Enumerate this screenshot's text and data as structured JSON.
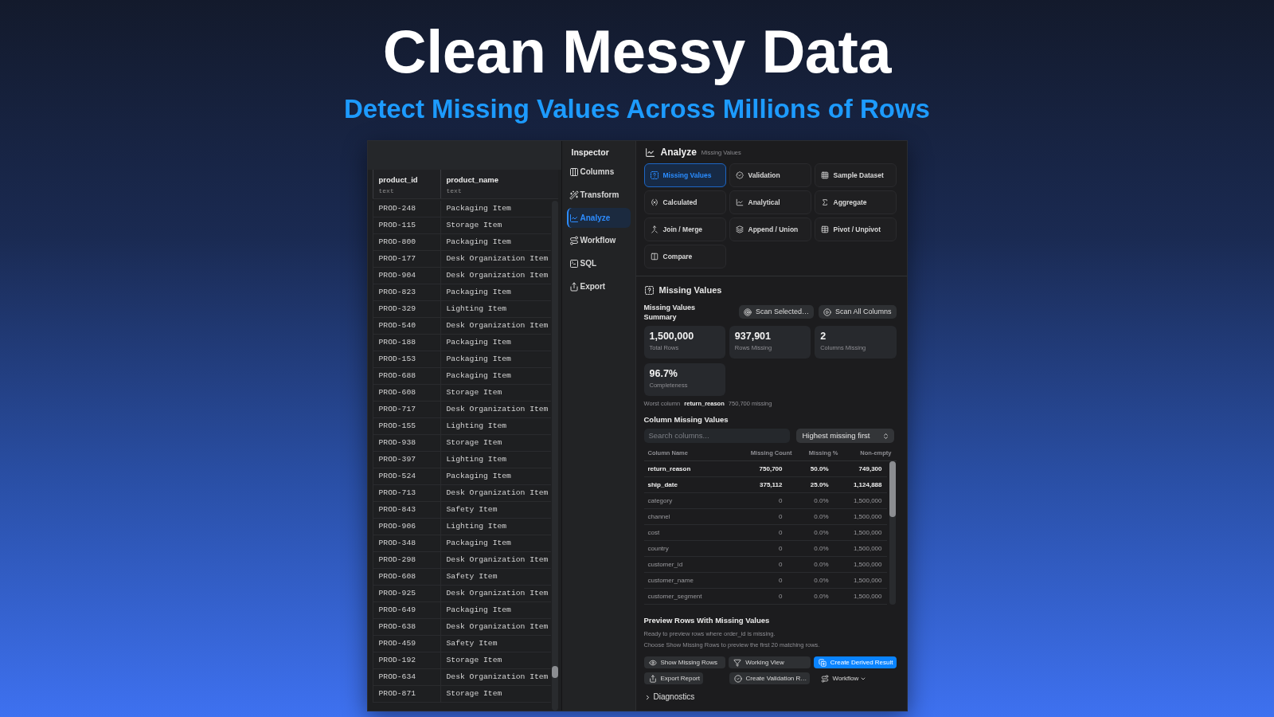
{
  "hero": {
    "title": "Clean Messy Data",
    "subtitle": "Detect Missing Values Across Millions of Rows"
  },
  "data_grid": {
    "columns": [
      {
        "name": "product_id",
        "type": "text"
      },
      {
        "name": "product_name",
        "type": "text"
      }
    ],
    "rows": [
      [
        "PROD-248",
        "Packaging Item"
      ],
      [
        "PROD-115",
        "Storage Item"
      ],
      [
        "PROD-800",
        "Packaging Item"
      ],
      [
        "PROD-177",
        "Desk Organization Item"
      ],
      [
        "PROD-904",
        "Desk Organization Item"
      ],
      [
        "PROD-823",
        "Packaging Item"
      ],
      [
        "PROD-329",
        "Lighting Item"
      ],
      [
        "PROD-540",
        "Desk Organization Item"
      ],
      [
        "PROD-188",
        "Packaging Item"
      ],
      [
        "PROD-153",
        "Packaging Item"
      ],
      [
        "PROD-688",
        "Packaging Item"
      ],
      [
        "PROD-608",
        "Storage Item"
      ],
      [
        "PROD-717",
        "Desk Organization Item"
      ],
      [
        "PROD-155",
        "Lighting Item"
      ],
      [
        "PROD-938",
        "Storage Item"
      ],
      [
        "PROD-397",
        "Lighting Item"
      ],
      [
        "PROD-524",
        "Packaging Item"
      ],
      [
        "PROD-713",
        "Desk Organization Item"
      ],
      [
        "PROD-843",
        "Safety Item"
      ],
      [
        "PROD-906",
        "Lighting Item"
      ],
      [
        "PROD-348",
        "Packaging Item"
      ],
      [
        "PROD-298",
        "Desk Organization Item"
      ],
      [
        "PROD-608",
        "Safety Item"
      ],
      [
        "PROD-925",
        "Desk Organization Item"
      ],
      [
        "PROD-649",
        "Packaging Item"
      ],
      [
        "PROD-638",
        "Desk Organization Item"
      ],
      [
        "PROD-459",
        "Safety Item"
      ],
      [
        "PROD-192",
        "Storage Item"
      ],
      [
        "PROD-634",
        "Desk Organization Item"
      ],
      [
        "PROD-871",
        "Storage Item"
      ]
    ]
  },
  "inspector": {
    "title": "Inspector",
    "items": [
      {
        "label": "Columns",
        "selected": false
      },
      {
        "label": "Transform",
        "selected": false
      },
      {
        "label": "Analyze",
        "selected": true
      },
      {
        "label": "Workflow",
        "selected": false
      },
      {
        "label": "SQL",
        "selected": false
      },
      {
        "label": "Export",
        "selected": false
      }
    ]
  },
  "analyze": {
    "title": "Analyze",
    "subtitle": "Missing Values",
    "tools": [
      {
        "label": "Missing Values",
        "selected": true
      },
      {
        "label": "Validation",
        "selected": false
      },
      {
        "label": "Sample Dataset",
        "selected": false
      },
      {
        "label": "Calculated",
        "selected": false
      },
      {
        "label": "Analytical",
        "selected": false
      },
      {
        "label": "Aggregate",
        "selected": false
      },
      {
        "label": "Join / Merge",
        "selected": false
      },
      {
        "label": "Append / Union",
        "selected": false
      },
      {
        "label": "Pivot / Unpivot",
        "selected": false
      },
      {
        "label": "Compare",
        "selected": false
      }
    ]
  },
  "missing_values": {
    "title": "Missing Values",
    "summary_title": "Missing Values Summary",
    "scan_buttons": [
      "Scan Selected…",
      "Scan All Columns"
    ],
    "stats": [
      {
        "value": "1,500,000",
        "label": "Total Rows"
      },
      {
        "value": "937,901",
        "label": "Rows Missing"
      },
      {
        "value": "2",
        "label": "Columns Missing"
      },
      {
        "value": "96.7%",
        "label": "Completeness"
      }
    ],
    "worst_column": "Worst column **return_reason** 750,700 missing",
    "column_section": {
      "title": "Column Missing Values",
      "search": {
        "placeholder": "Search columns..."
      },
      "sort": {
        "value": "Highest missing first"
      },
      "table": {
        "columns": [
          "Column Name",
          "Missing Count",
          "Missing %",
          "Non-empty"
        ],
        "rows": [
          {
            "cells": [
              "return_reason",
              "750,700",
              "50.0%",
              "749,300"
            ],
            "bold": true
          },
          {
            "cells": [
              "ship_date",
              "375,112",
              "25.0%",
              "1,124,888"
            ],
            "bold": true
          },
          {
            "cells": [
              "category",
              "0",
              "0.0%",
              "1,500,000"
            ],
            "bold": false
          },
          {
            "cells": [
              "channel",
              "0",
              "0.0%",
              "1,500,000"
            ],
            "bold": false
          },
          {
            "cells": [
              "cost",
              "0",
              "0.0%",
              "1,500,000"
            ],
            "bold": false
          },
          {
            "cells": [
              "country",
              "0",
              "0.0%",
              "1,500,000"
            ],
            "bold": false
          },
          {
            "cells": [
              "customer_id",
              "0",
              "0.0%",
              "1,500,000"
            ],
            "bold": false
          },
          {
            "cells": [
              "customer_name",
              "0",
              "0.0%",
              "1,500,000"
            ],
            "bold": false
          },
          {
            "cells": [
              "customer_segment",
              "0",
              "0.0%",
              "1,500,000"
            ],
            "bold": false
          }
        ]
      }
    }
  },
  "preview": {
    "title": "Preview Rows With Missing Values",
    "lines": [
      "Ready to preview rows where order_id is missing.",
      "Choose Show Missing Rows to preview the first 20 matching rows."
    ],
    "action_rows": [
      [
        {
          "label": "Show Missing Rows",
          "kind": "secondary"
        },
        {
          "label": "Working View",
          "kind": "secondary"
        },
        {
          "label": "Create Derived Result",
          "kind": "primary"
        }
      ],
      [
        {
          "label": "Export Report",
          "kind": "secondary"
        },
        {
          "label": "Create Validation R…",
          "kind": "secondary"
        },
        {
          "label": "Workflow",
          "kind": "menu"
        }
      ]
    ],
    "diagnostics": {
      "label": "Diagnostics",
      "expanded": false
    }
  }
}
